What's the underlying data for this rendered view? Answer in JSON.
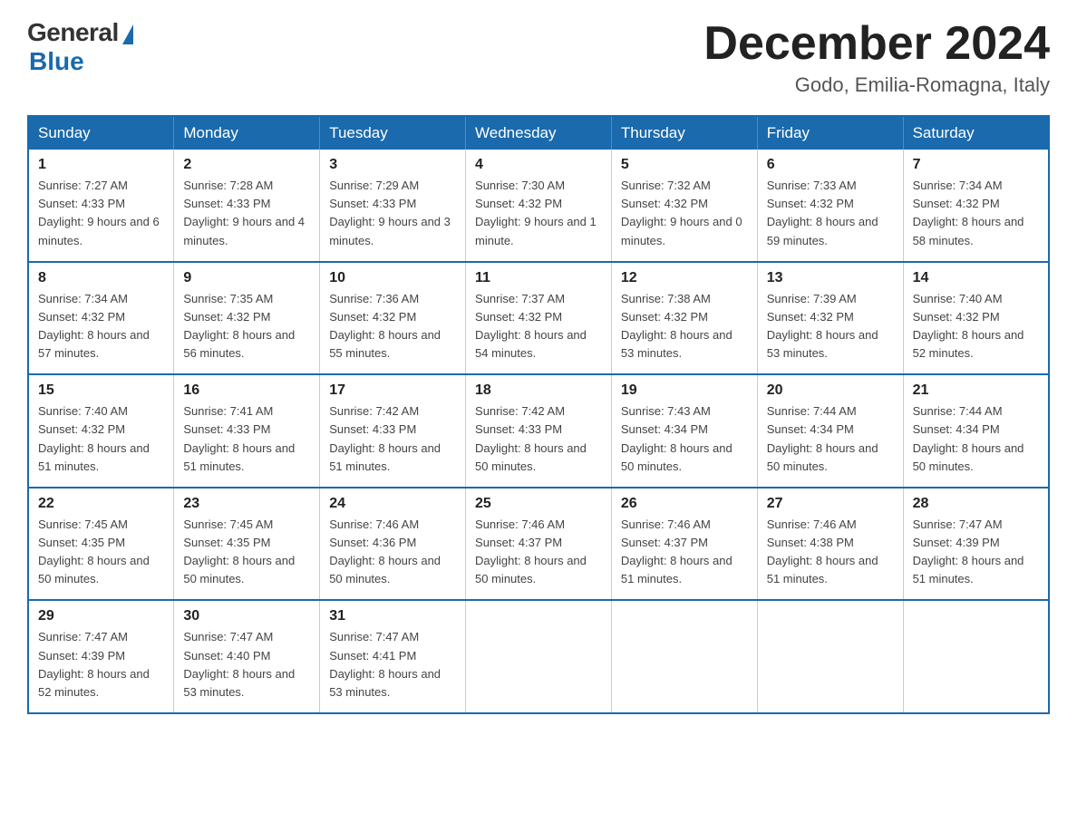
{
  "logo": {
    "general_text": "General",
    "blue_text": "Blue"
  },
  "header": {
    "month_year": "December 2024",
    "location": "Godo, Emilia-Romagna, Italy"
  },
  "days_of_week": [
    "Sunday",
    "Monday",
    "Tuesday",
    "Wednesday",
    "Thursday",
    "Friday",
    "Saturday"
  ],
  "weeks": [
    [
      {
        "day": "1",
        "sunrise": "7:27 AM",
        "sunset": "4:33 PM",
        "daylight": "9 hours and 6 minutes."
      },
      {
        "day": "2",
        "sunrise": "7:28 AM",
        "sunset": "4:33 PM",
        "daylight": "9 hours and 4 minutes."
      },
      {
        "day": "3",
        "sunrise": "7:29 AM",
        "sunset": "4:33 PM",
        "daylight": "9 hours and 3 minutes."
      },
      {
        "day": "4",
        "sunrise": "7:30 AM",
        "sunset": "4:32 PM",
        "daylight": "9 hours and 1 minute."
      },
      {
        "day": "5",
        "sunrise": "7:32 AM",
        "sunset": "4:32 PM",
        "daylight": "9 hours and 0 minutes."
      },
      {
        "day": "6",
        "sunrise": "7:33 AM",
        "sunset": "4:32 PM",
        "daylight": "8 hours and 59 minutes."
      },
      {
        "day": "7",
        "sunrise": "7:34 AM",
        "sunset": "4:32 PM",
        "daylight": "8 hours and 58 minutes."
      }
    ],
    [
      {
        "day": "8",
        "sunrise": "7:34 AM",
        "sunset": "4:32 PM",
        "daylight": "8 hours and 57 minutes."
      },
      {
        "day": "9",
        "sunrise": "7:35 AM",
        "sunset": "4:32 PM",
        "daylight": "8 hours and 56 minutes."
      },
      {
        "day": "10",
        "sunrise": "7:36 AM",
        "sunset": "4:32 PM",
        "daylight": "8 hours and 55 minutes."
      },
      {
        "day": "11",
        "sunrise": "7:37 AM",
        "sunset": "4:32 PM",
        "daylight": "8 hours and 54 minutes."
      },
      {
        "day": "12",
        "sunrise": "7:38 AM",
        "sunset": "4:32 PM",
        "daylight": "8 hours and 53 minutes."
      },
      {
        "day": "13",
        "sunrise": "7:39 AM",
        "sunset": "4:32 PM",
        "daylight": "8 hours and 53 minutes."
      },
      {
        "day": "14",
        "sunrise": "7:40 AM",
        "sunset": "4:32 PM",
        "daylight": "8 hours and 52 minutes."
      }
    ],
    [
      {
        "day": "15",
        "sunrise": "7:40 AM",
        "sunset": "4:32 PM",
        "daylight": "8 hours and 51 minutes."
      },
      {
        "day": "16",
        "sunrise": "7:41 AM",
        "sunset": "4:33 PM",
        "daylight": "8 hours and 51 minutes."
      },
      {
        "day": "17",
        "sunrise": "7:42 AM",
        "sunset": "4:33 PM",
        "daylight": "8 hours and 51 minutes."
      },
      {
        "day": "18",
        "sunrise": "7:42 AM",
        "sunset": "4:33 PM",
        "daylight": "8 hours and 50 minutes."
      },
      {
        "day": "19",
        "sunrise": "7:43 AM",
        "sunset": "4:34 PM",
        "daylight": "8 hours and 50 minutes."
      },
      {
        "day": "20",
        "sunrise": "7:44 AM",
        "sunset": "4:34 PM",
        "daylight": "8 hours and 50 minutes."
      },
      {
        "day": "21",
        "sunrise": "7:44 AM",
        "sunset": "4:34 PM",
        "daylight": "8 hours and 50 minutes."
      }
    ],
    [
      {
        "day": "22",
        "sunrise": "7:45 AM",
        "sunset": "4:35 PM",
        "daylight": "8 hours and 50 minutes."
      },
      {
        "day": "23",
        "sunrise": "7:45 AM",
        "sunset": "4:35 PM",
        "daylight": "8 hours and 50 minutes."
      },
      {
        "day": "24",
        "sunrise": "7:46 AM",
        "sunset": "4:36 PM",
        "daylight": "8 hours and 50 minutes."
      },
      {
        "day": "25",
        "sunrise": "7:46 AM",
        "sunset": "4:37 PM",
        "daylight": "8 hours and 50 minutes."
      },
      {
        "day": "26",
        "sunrise": "7:46 AM",
        "sunset": "4:37 PM",
        "daylight": "8 hours and 51 minutes."
      },
      {
        "day": "27",
        "sunrise": "7:46 AM",
        "sunset": "4:38 PM",
        "daylight": "8 hours and 51 minutes."
      },
      {
        "day": "28",
        "sunrise": "7:47 AM",
        "sunset": "4:39 PM",
        "daylight": "8 hours and 51 minutes."
      }
    ],
    [
      {
        "day": "29",
        "sunrise": "7:47 AM",
        "sunset": "4:39 PM",
        "daylight": "8 hours and 52 minutes."
      },
      {
        "day": "30",
        "sunrise": "7:47 AM",
        "sunset": "4:40 PM",
        "daylight": "8 hours and 53 minutes."
      },
      {
        "day": "31",
        "sunrise": "7:47 AM",
        "sunset": "4:41 PM",
        "daylight": "8 hours and 53 minutes."
      },
      null,
      null,
      null,
      null
    ]
  ]
}
